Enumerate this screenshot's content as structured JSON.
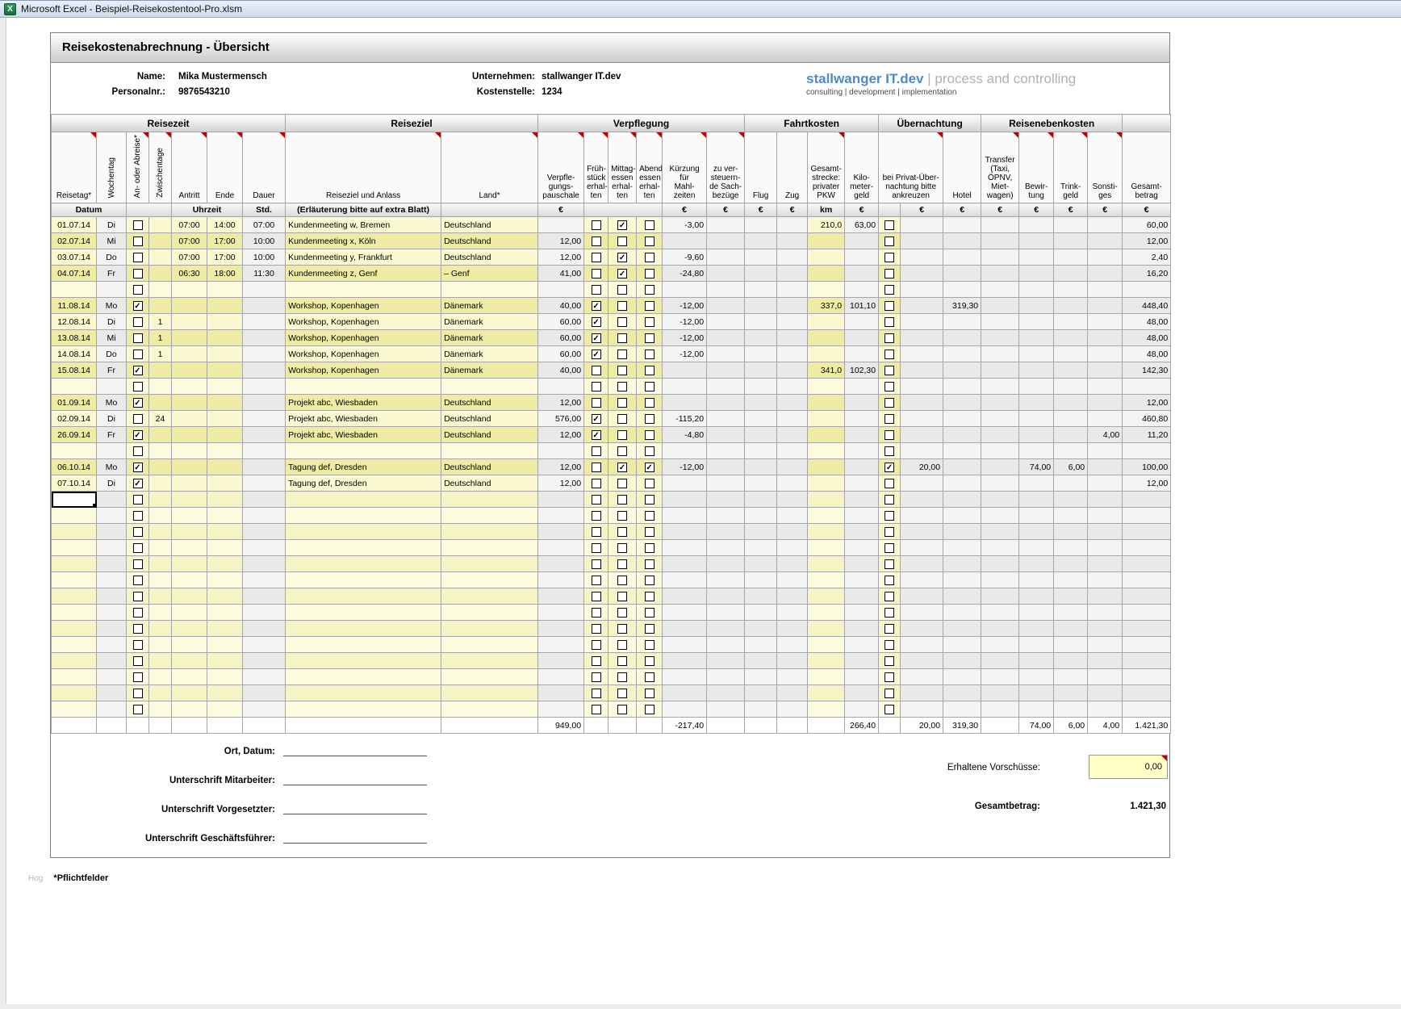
{
  "window": {
    "title": "Microsoft Excel - Beispiel-Reisekostentool-Pro.xlsm",
    "icon": "excel-icon"
  },
  "form": {
    "title": "Reisekostenabrechnung - Übersicht",
    "info": {
      "name_label": "Name:",
      "name": "Mika Mustermensch",
      "personalnr_label": "Personalnr.:",
      "personalnr": "9876543210",
      "unternehmen_label": "Unternehmen:",
      "unternehmen": "stallwanger IT.dev",
      "kostenstelle_label": "Kostenstelle:",
      "kostenstelle": "1234"
    },
    "logo": {
      "brand": "stallwanger IT.dev",
      "divider": " | ",
      "tagline": "process and controlling",
      "subline": "consulting | development | implementation",
      "brand_color": "#4e8bc4"
    }
  },
  "table": {
    "groups": [
      "Reisezeit",
      "Reiseziel",
      "Verpflegung",
      "Fahrtkosten",
      "Übernachtung",
      "Reisenebenkosten"
    ],
    "columns": {
      "reisetag": "Reisetag*",
      "wochentag": "Wochentag",
      "an_abreise": "An- oder Abreise*",
      "zwischentage": "Zwischentage",
      "antritt": "Antritt",
      "ende": "Ende",
      "dauer": "Dauer",
      "reiseziel": "Reiseziel und Anlass",
      "land": "Land*",
      "verpflegung": "Verpfle-\ngungs-\npauschale",
      "fruehstueck": "Früh-\nstück\nerhal-\nten",
      "mittagessen": "Mittag-\nessen\nerhal-\nten",
      "abendessen": "Abend-\nessen\nerhal-\nten",
      "kuerzung": "Kürzung\nfür\nMahl-\nzeiten",
      "sachbezuege": "zu ver-\nsteuern-\nde Sach-\nbezüge",
      "flug": "Flug",
      "zug": "Zug",
      "pkw": "Gesamt-\nstrecke:\nprivater\nPKW",
      "kmgeld": "Kilo-\nmeter-\ngeld",
      "privat": "bei Privat-Über-\nnachtung bitte\nankreuzen",
      "hotel": "Hotel",
      "transfer": "Transfer\n(Taxi,\nÖPNV,\nMiet-\nwagen)",
      "bewirtung": "Bewir-\ntung",
      "trinkgeld": "Trink-\ngeld",
      "sonstiges": "Sonsti-\nges",
      "gesamt": "Gesamt-\nbetrag"
    },
    "subheader": {
      "datum": "Datum",
      "uhrzeit": "Uhrzeit",
      "std": "Std.",
      "erlaeuterung": "(Erläuterung bitte auf extra Blatt)",
      "eur": "€",
      "km": "km"
    },
    "rows": [
      {
        "reisetag": "01.07.14",
        "wochentag": "Di",
        "an_abreise": false,
        "zwischentage": "",
        "antritt": "07:00",
        "ende": "14:00",
        "dauer": "07:00",
        "reiseziel": "Kundenmeeting w, Bremen",
        "land": "Deutschland",
        "verpflegung": "",
        "fruehstueck": false,
        "mittagessen": true,
        "abendessen": false,
        "kuerzung": "-3,00",
        "sachbezuege": "",
        "flug": "",
        "zug": "",
        "pkw": "210,0",
        "kmgeld": "63,00",
        "privat": false,
        "privat_betrag": "",
        "hotel": "",
        "transfer": "",
        "bewirtung": "",
        "trinkgeld": "",
        "sonstiges": "",
        "gesamt": "60,00"
      },
      {
        "reisetag": "02.07.14",
        "wochentag": "Mi",
        "an_abreise": false,
        "zwischentage": "",
        "antritt": "07:00",
        "ende": "17:00",
        "dauer": "10:00",
        "reiseziel": "Kundenmeeting x, Köln",
        "land": "Deutschland",
        "verpflegung": "12,00",
        "fruehstueck": false,
        "mittagessen": false,
        "abendessen": false,
        "kuerzung": "",
        "sachbezuege": "",
        "flug": "",
        "zug": "",
        "pkw": "",
        "kmgeld": "",
        "privat": false,
        "privat_betrag": "",
        "hotel": "",
        "transfer": "",
        "bewirtung": "",
        "trinkgeld": "",
        "sonstiges": "",
        "gesamt": "12,00"
      },
      {
        "reisetag": "03.07.14",
        "wochentag": "Do",
        "an_abreise": false,
        "zwischentage": "",
        "antritt": "07:00",
        "ende": "17:00",
        "dauer": "10:00",
        "reiseziel": "Kundenmeeting y, Frankfurt",
        "land": "Deutschland",
        "verpflegung": "12,00",
        "fruehstueck": false,
        "mittagessen": true,
        "abendessen": false,
        "kuerzung": "-9,60",
        "sachbezuege": "",
        "flug": "",
        "zug": "",
        "pkw": "",
        "kmgeld": "",
        "privat": false,
        "privat_betrag": "",
        "hotel": "",
        "transfer": "",
        "bewirtung": "",
        "trinkgeld": "",
        "sonstiges": "",
        "gesamt": "2,40"
      },
      {
        "reisetag": "04.07.14",
        "wochentag": "Fr",
        "an_abreise": false,
        "zwischentage": "",
        "antritt": "06:30",
        "ende": "18:00",
        "dauer": "11:30",
        "reiseziel": "Kundenmeeting z, Genf",
        "land": "– Genf",
        "verpflegung": "41,00",
        "fruehstueck": false,
        "mittagessen": true,
        "abendessen": false,
        "kuerzung": "-24,80",
        "sachbezuege": "",
        "flug": "",
        "zug": "",
        "pkw": "",
        "kmgeld": "",
        "privat": false,
        "privat_betrag": "",
        "hotel": "",
        "transfer": "",
        "bewirtung": "",
        "trinkgeld": "",
        "sonstiges": "",
        "gesamt": "16,20"
      },
      {
        "separator": true
      },
      {
        "reisetag": "11.08.14",
        "wochentag": "Mo",
        "an_abreise": true,
        "zwischentage": "",
        "antritt": "",
        "ende": "",
        "dauer": "",
        "reiseziel": "Workshop, Kopenhagen",
        "land": "Dänemark",
        "verpflegung": "40,00",
        "fruehstueck": true,
        "mittagessen": false,
        "abendessen": false,
        "kuerzung": "-12,00",
        "sachbezuege": "",
        "flug": "",
        "zug": "",
        "pkw": "337,0",
        "kmgeld": "101,10",
        "privat": false,
        "privat_betrag": "",
        "hotel": "319,30",
        "transfer": "",
        "bewirtung": "",
        "trinkgeld": "",
        "sonstiges": "",
        "gesamt": "448,40"
      },
      {
        "reisetag": "12.08.14",
        "wochentag": "Di",
        "an_abreise": false,
        "zwischentage": "1",
        "antritt": "",
        "ende": "",
        "dauer": "",
        "reiseziel": "Workshop, Kopenhagen",
        "land": "Dänemark",
        "verpflegung": "60,00",
        "fruehstueck": true,
        "mittagessen": false,
        "abendessen": false,
        "kuerzung": "-12,00",
        "sachbezuege": "",
        "flug": "",
        "zug": "",
        "pkw": "",
        "kmgeld": "",
        "privat": false,
        "privat_betrag": "",
        "hotel": "",
        "transfer": "",
        "bewirtung": "",
        "trinkgeld": "",
        "sonstiges": "",
        "gesamt": "48,00"
      },
      {
        "reisetag": "13.08.14",
        "wochentag": "Mi",
        "an_abreise": false,
        "zwischentage": "1",
        "antritt": "",
        "ende": "",
        "dauer": "",
        "reiseziel": "Workshop, Kopenhagen",
        "land": "Dänemark",
        "verpflegung": "60,00",
        "fruehstueck": true,
        "mittagessen": false,
        "abendessen": false,
        "kuerzung": "-12,00",
        "sachbezuege": "",
        "flug": "",
        "zug": "",
        "pkw": "",
        "kmgeld": "",
        "privat": false,
        "privat_betrag": "",
        "hotel": "",
        "transfer": "",
        "bewirtung": "",
        "trinkgeld": "",
        "sonstiges": "",
        "gesamt": "48,00"
      },
      {
        "reisetag": "14.08.14",
        "wochentag": "Do",
        "an_abreise": false,
        "zwischentage": "1",
        "antritt": "",
        "ende": "",
        "dauer": "",
        "reiseziel": "Workshop, Kopenhagen",
        "land": "Dänemark",
        "verpflegung": "60,00",
        "fruehstueck": true,
        "mittagessen": false,
        "abendessen": false,
        "kuerzung": "-12,00",
        "sachbezuege": "",
        "flug": "",
        "zug": "",
        "pkw": "",
        "kmgeld": "",
        "privat": false,
        "privat_betrag": "",
        "hotel": "",
        "transfer": "",
        "bewirtung": "",
        "trinkgeld": "",
        "sonstiges": "",
        "gesamt": "48,00"
      },
      {
        "reisetag": "15.08.14",
        "wochentag": "Fr",
        "an_abreise": true,
        "zwischentage": "",
        "antritt": "",
        "ende": "",
        "dauer": "",
        "reiseziel": "Workshop, Kopenhagen",
        "land": "Dänemark",
        "verpflegung": "40,00",
        "fruehstueck": false,
        "mittagessen": false,
        "abendessen": false,
        "kuerzung": "",
        "sachbezuege": "",
        "flug": "",
        "zug": "",
        "pkw": "341,0",
        "kmgeld": "102,30",
        "privat": false,
        "privat_betrag": "",
        "hotel": "",
        "transfer": "",
        "bewirtung": "",
        "trinkgeld": "",
        "sonstiges": "",
        "gesamt": "142,30"
      },
      {
        "separator": true
      },
      {
        "reisetag": "01.09.14",
        "wochentag": "Mo",
        "an_abreise": true,
        "zwischentage": "",
        "antritt": "",
        "ende": "",
        "dauer": "",
        "reiseziel": "Projekt abc, Wiesbaden",
        "land": "Deutschland",
        "verpflegung": "12,00",
        "fruehstueck": false,
        "mittagessen": false,
        "abendessen": false,
        "kuerzung": "",
        "sachbezuege": "",
        "flug": "",
        "zug": "",
        "pkw": "",
        "kmgeld": "",
        "privat": false,
        "privat_betrag": "",
        "hotel": "",
        "transfer": "",
        "bewirtung": "",
        "trinkgeld": "",
        "sonstiges": "",
        "gesamt": "12,00"
      },
      {
        "reisetag": "02.09.14",
        "wochentag": "Di",
        "an_abreise": false,
        "zwischentage": "24",
        "antritt": "",
        "ende": "",
        "dauer": "",
        "reiseziel": "Projekt abc, Wiesbaden",
        "land": "Deutschland",
        "verpflegung": "576,00",
        "fruehstueck": true,
        "mittagessen": false,
        "abendessen": false,
        "kuerzung": "-115,20",
        "sachbezuege": "",
        "flug": "",
        "zug": "",
        "pkw": "",
        "kmgeld": "",
        "privat": false,
        "privat_betrag": "",
        "hotel": "",
        "transfer": "",
        "bewirtung": "",
        "trinkgeld": "",
        "sonstiges": "",
        "gesamt": "460,80"
      },
      {
        "reisetag": "26.09.14",
        "wochentag": "Fr",
        "an_abreise": true,
        "zwischentage": "",
        "antritt": "",
        "ende": "",
        "dauer": "",
        "reiseziel": "Projekt abc, Wiesbaden",
        "land": "Deutschland",
        "verpflegung": "12,00",
        "fruehstueck": true,
        "mittagessen": false,
        "abendessen": false,
        "kuerzung": "-4,80",
        "sachbezuege": "",
        "flug": "",
        "zug": "",
        "pkw": "",
        "kmgeld": "",
        "privat": false,
        "privat_betrag": "",
        "hotel": "",
        "transfer": "",
        "bewirtung": "",
        "trinkgeld": "",
        "sonstiges": "4,00",
        "gesamt": "11,20"
      },
      {
        "separator": true
      },
      {
        "reisetag": "06.10.14",
        "wochentag": "Mo",
        "an_abreise": true,
        "zwischentage": "",
        "antritt": "",
        "ende": "",
        "dauer": "",
        "reiseziel": "Tagung def, Dresden",
        "land": "Deutschland",
        "verpflegung": "12,00",
        "fruehstueck": false,
        "mittagessen": true,
        "abendessen": true,
        "kuerzung": "-12,00",
        "sachbezuege": "",
        "flug": "",
        "zug": "",
        "pkw": "",
        "kmgeld": "",
        "privat": true,
        "privat_betrag": "20,00",
        "hotel": "",
        "transfer": "",
        "bewirtung": "74,00",
        "trinkgeld": "6,00",
        "sonstiges": "",
        "gesamt": "100,00"
      },
      {
        "reisetag": "07.10.14",
        "wochentag": "Di",
        "an_abreise": true,
        "zwischentage": "",
        "antritt": "",
        "ende": "",
        "dauer": "",
        "reiseziel": "Tagung def, Dresden",
        "land": "Deutschland",
        "verpflegung": "12,00",
        "fruehstueck": false,
        "mittagessen": false,
        "abendessen": false,
        "kuerzung": "",
        "sachbezuege": "",
        "flug": "",
        "zug": "",
        "pkw": "",
        "kmgeld": "",
        "privat": false,
        "privat_betrag": "",
        "hotel": "",
        "transfer": "",
        "bewirtung": "",
        "trinkgeld": "",
        "sonstiges": "",
        "gesamt": "12,00"
      }
    ],
    "trailing_empty_rows": 14,
    "totals": {
      "verpflegung": "949,00",
      "kuerzung": "-217,40",
      "kmgeld": "266,40",
      "privat_betrag": "20,00",
      "hotel": "319,30",
      "bewirtung": "74,00",
      "trinkgeld": "6,00",
      "sonstiges": "4,00",
      "gesamt": "1.421,30"
    }
  },
  "footer": {
    "ort_datum_label": "Ort, Datum:",
    "unterschrift_mitarbeiter_label": "Unterschrift Mitarbeiter:",
    "unterschrift_vorgesetzter_label": "Unterschrift Vorgesetzter:",
    "unterschrift_geschaeftsfuehrer_label": "Unterschrift Geschäftsführer:",
    "vorschuesse_label": "Erhaltene Vorschüsse:",
    "vorschuesse_value": "0,00",
    "gesamtbetrag_label": "Gesamtbetrag:",
    "gesamtbetrag_value": "1.421,30",
    "artifact": "Hog",
    "pflichtfelder": "*Pflichtfelder"
  }
}
